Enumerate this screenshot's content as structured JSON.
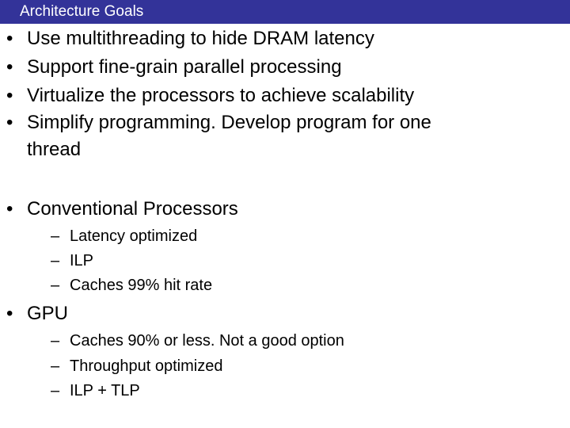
{
  "header": {
    "title": "Architecture Goals",
    "color": "#333399"
  },
  "goals": [
    {
      "text": "Use multithreading to hide DRAM latency"
    },
    {
      "text": "Support fine-grain parallel processing"
    },
    {
      "text": "Virtualize the processors to achieve scalability"
    },
    {
      "text": "Simplify programming. Develop program for one",
      "continuation": "thread"
    }
  ],
  "sections": [
    {
      "title": "Conventional Processors",
      "subitems": [
        "Latency optimized",
        "ILP",
        "Caches 99% hit rate"
      ]
    },
    {
      "title": "GPU",
      "subitems": [
        "Caches 90% or less. Not a good option",
        "Throughput optimized",
        "ILP + TLP"
      ]
    }
  ],
  "glyphs": {
    "bullet": "•",
    "dash": "–"
  }
}
